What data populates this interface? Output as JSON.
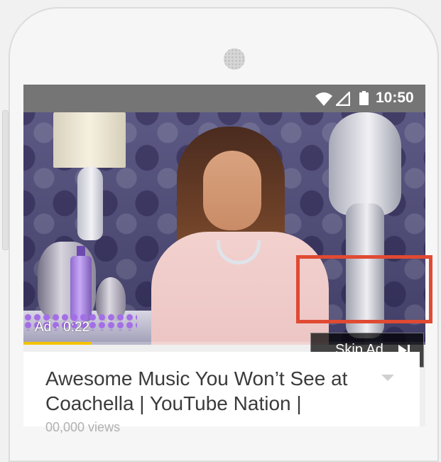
{
  "status_bar": {
    "time": "10:50",
    "icons": [
      "wifi-icon",
      "signal-icon",
      "battery-icon"
    ],
    "background": "#757575"
  },
  "video": {
    "ad_label": "Ad · 0:22",
    "ad_progress_fraction": 0.17,
    "progress_color": "#f4c300",
    "skip_button": {
      "label": "Skip Ad",
      "icon": "skip-next-icon"
    },
    "highlight_color": "#e04a33"
  },
  "details": {
    "title": "Awesome Music You Won’t See at Coachella | YouTube Nation |",
    "views": "00,000 views",
    "dropdown_icon": "chevron-down-icon"
  }
}
